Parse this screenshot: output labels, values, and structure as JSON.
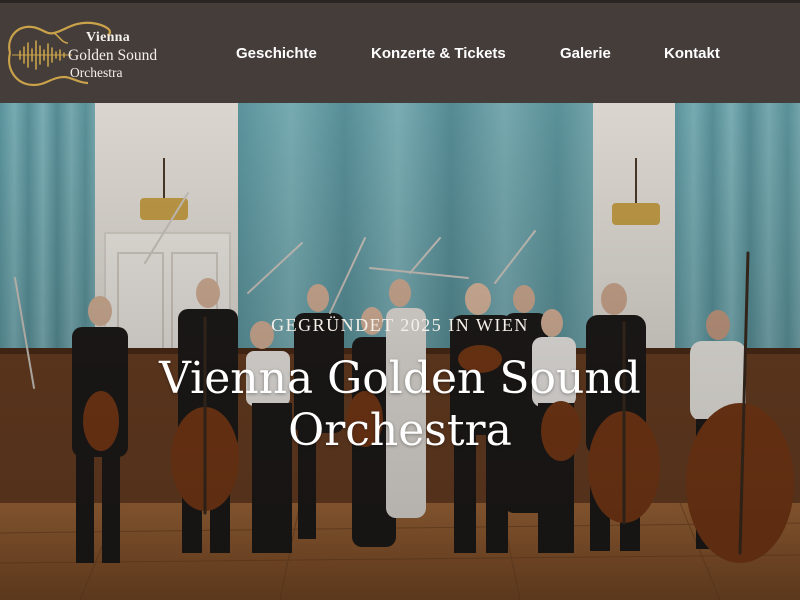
{
  "brand": {
    "logo_line1": "Vienna",
    "logo_line2": "Golden Sound",
    "logo_line3": "Orchestra",
    "gold": "#c9a24a"
  },
  "nav": {
    "items": [
      {
        "label": "Geschichte"
      },
      {
        "label": "Konzerte & Tickets"
      },
      {
        "label": "Galerie"
      },
      {
        "label": "Kontakt"
      }
    ]
  },
  "hero": {
    "kicker": "Gegründet 2025 in Wien",
    "title_line1": "Vienna Golden Sound",
    "title_line2": "Orchestra"
  }
}
